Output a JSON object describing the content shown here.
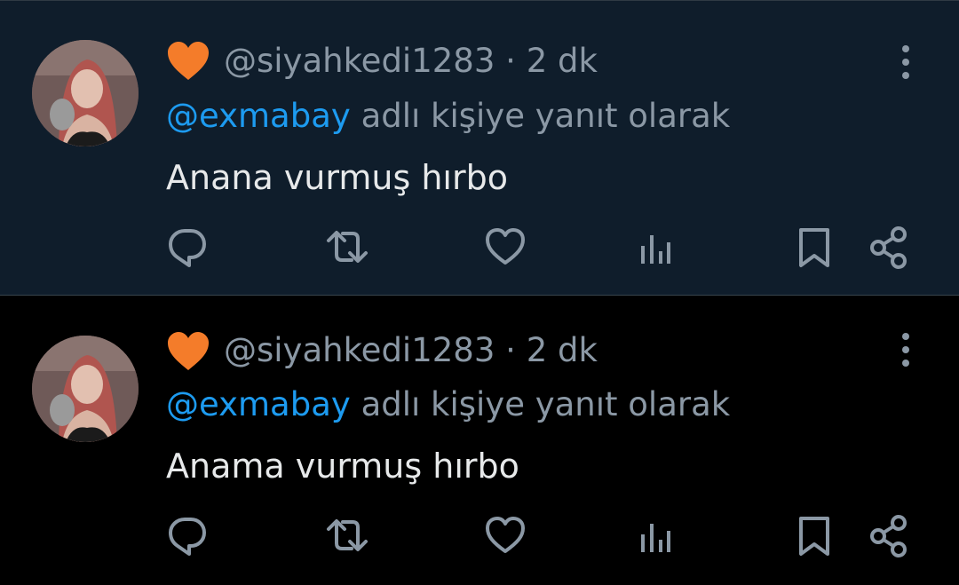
{
  "tweets": [
    {
      "emoji": "🧡",
      "handle": "@siyahkedi1283",
      "separator": "·",
      "time": "2 dk",
      "reply_mention": "@exmabay",
      "reply_suffix": "adlı kişiye yanıt olarak",
      "text": "Anana vurmuş hırbo"
    },
    {
      "emoji": "🧡",
      "handle": "@siyahkedi1283",
      "separator": "·",
      "time": "2 dk",
      "reply_mention": "@exmabay",
      "reply_suffix": "adlı kişiye yanıt olarak",
      "text": "Anama vurmuş hırbo"
    }
  ],
  "icons": {
    "reply": "reply-icon",
    "retweet": "retweet-icon",
    "like": "heart-icon",
    "views": "views-icon",
    "bookmark": "bookmark-icon",
    "share": "share-icon",
    "more": "more-icon"
  },
  "colors": {
    "highlight_bg": "#0f1d2b",
    "bg": "#000000",
    "mention": "#1d9bf0",
    "secondary_text": "#8b98a5",
    "primary_text": "#e7e9ea",
    "icon": "#8b98a5",
    "heart_emoji": "#f47c2a"
  }
}
